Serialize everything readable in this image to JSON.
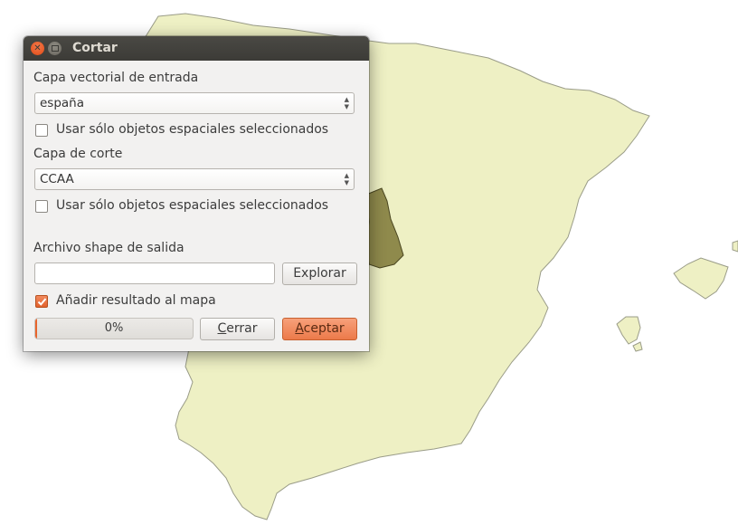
{
  "colors": {
    "map_fill": "#eef0c4",
    "map_stroke": "#9a9c88",
    "region_selected": "#8f8a4c",
    "accent": "#ec7a4a"
  },
  "dialog": {
    "title": "Cortar",
    "input_layer_label": "Capa vectorial de entrada",
    "input_layer_value": "españa",
    "input_selected_only_label": "Usar sólo objetos espaciales seleccionados",
    "input_selected_only_checked": false,
    "clip_layer_label": "Capa de corte",
    "clip_layer_value": "CCAA",
    "clip_selected_only_label": "Usar sólo objetos espaciales seleccionados",
    "clip_selected_only_checked": false,
    "output_label": "Archivo shape de salida",
    "output_value": "",
    "browse_button": "Explorar",
    "add_to_map_label": "Añadir resultado al mapa",
    "add_to_map_checked": true,
    "progress_value": 0,
    "progress_text": "0%",
    "close_button": {
      "accel": "C",
      "rest": "errar"
    },
    "accept_button": {
      "accel": "A",
      "rest": "ceptar"
    }
  }
}
